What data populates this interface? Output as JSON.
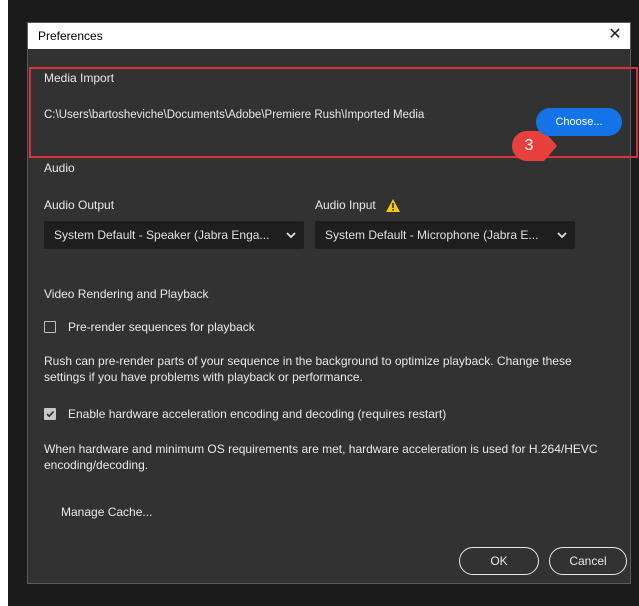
{
  "window": {
    "title": "Preferences"
  },
  "media_import": {
    "heading": "Media Import",
    "path": "C:\\Users\\bartosheviche\\Documents\\Adobe\\Premiere Rush\\Imported Media",
    "choose_label": "Choose...",
    "callout_number": "3"
  },
  "audio": {
    "heading": "Audio",
    "output_label": "Audio Output",
    "output_value": "System Default - Speaker (Jabra Enga...",
    "input_label": "Audio Input",
    "input_value": "System Default - Microphone (Jabra E..."
  },
  "video": {
    "heading": "Video Rendering and Playback",
    "prerender_label": "Pre-render sequences for playback",
    "prerender_checked": false,
    "prerender_desc": "Rush can pre-render parts of your sequence in the background to optimize playback. Change these settings if you have problems with playback or performance.",
    "hwaccel_label": "Enable hardware acceleration encoding and decoding (requires restart)",
    "hwaccel_checked": true,
    "hwaccel_desc": "When hardware and minimum OS requirements are met, hardware acceleration is used for H.264/HEVC encoding/decoding."
  },
  "manage_cache_label": "Manage Cache...",
  "buttons": {
    "ok": "OK",
    "cancel": "Cancel"
  },
  "colors": {
    "accent": "#1473e6",
    "highlight": "#d9323a",
    "warning": "#f5c518",
    "dialog_bg": "#323232"
  }
}
